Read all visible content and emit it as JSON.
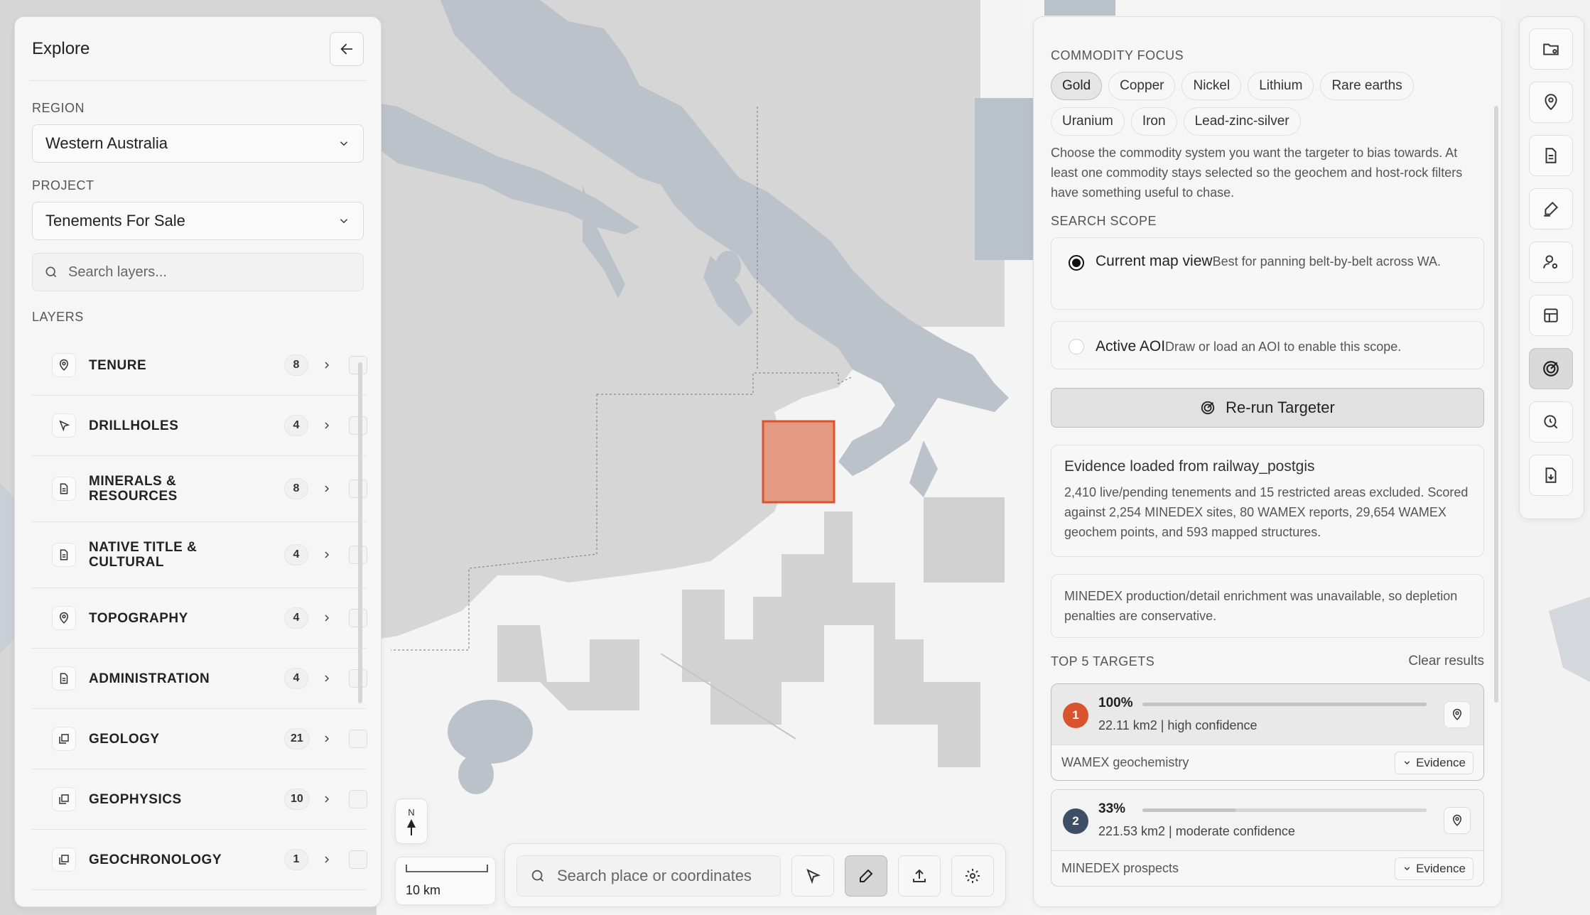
{
  "left_panel": {
    "title": "Explore",
    "region_label": "REGION",
    "region_value": "Western Australia",
    "project_label": "PROJECT",
    "project_value": "Tenements For Sale",
    "search_placeholder": "Search layers...",
    "layers_label": "LAYERS",
    "layers": [
      {
        "name": "TENURE",
        "count": "8",
        "icon": "pin-icon"
      },
      {
        "name": "DRILLHOLES",
        "count": "4",
        "icon": "cursor-icon"
      },
      {
        "name": "MINERALS & RESOURCES",
        "count": "8",
        "icon": "document-icon"
      },
      {
        "name": "NATIVE TITLE & CULTURAL",
        "count": "4",
        "icon": "document-icon"
      },
      {
        "name": "TOPOGRAPHY",
        "count": "4",
        "icon": "pin-icon"
      },
      {
        "name": "ADMINISTRATION",
        "count": "4",
        "icon": "document-icon"
      },
      {
        "name": "GEOLOGY",
        "count": "21",
        "icon": "layers-icon"
      },
      {
        "name": "GEOPHYSICS",
        "count": "10",
        "icon": "layers-icon"
      },
      {
        "name": "GEOCHRONOLOGY",
        "count": "1",
        "icon": "layers-icon"
      }
    ]
  },
  "right_panel": {
    "commodity_label": "COMMODITY FOCUS",
    "commodities": [
      {
        "label": "Gold",
        "selected": true
      },
      {
        "label": "Copper",
        "selected": false
      },
      {
        "label": "Nickel",
        "selected": false
      },
      {
        "label": "Lithium",
        "selected": false
      },
      {
        "label": "Rare earths",
        "selected": false
      },
      {
        "label": "Uranium",
        "selected": false
      },
      {
        "label": "Iron",
        "selected": false
      },
      {
        "label": "Lead-zinc-silver",
        "selected": false
      }
    ],
    "commodity_desc": "Choose the commodity system you want the targeter to bias towards. At least one commodity stays selected so the geochem and host-rock filters have something useful to chase.",
    "scope_label": "SEARCH SCOPE",
    "scope_options": [
      {
        "title": "Current map view",
        "desc": "Best for panning belt-by-belt across WA.",
        "selected": true
      },
      {
        "title": "Active AOI",
        "desc": "Draw or load an AOI to enable this scope.",
        "selected": false
      }
    ],
    "rerun_label": "Re-run Targeter",
    "evidence_title": "Evidence loaded from railway_postgis",
    "evidence_desc": "2,410 live/pending tenements and 15 restricted areas excluded. Scored against 2,254 MINEDEX sites, 80 WAMEX reports, 29,654 WAMEX geochem points, and 593 mapped structures.",
    "note": "MINEDEX production/detail enrichment was unavailable, so depletion penalties are conservative.",
    "targets_label": "TOP 5 TARGETS",
    "clear_label": "Clear results",
    "evidence_button": "Evidence",
    "targets": [
      {
        "rank": "1",
        "pct": "100%",
        "fraction": 1.0,
        "detail": "22.11 km2 | high confidence",
        "source": "WAMEX geochemistry",
        "color": "#d9532f"
      },
      {
        "rank": "2",
        "pct": "33%",
        "fraction": 0.33,
        "detail": "221.53 km2 | moderate confidence",
        "source": "MINEDEX prospects",
        "color": "#3d4e66"
      }
    ]
  },
  "map": {
    "compass": "N",
    "scale": "10 km",
    "search_placeholder": "Search place or coordinates",
    "highlight_color": "#e49a80",
    "highlight_border": "#d9532f"
  },
  "toolbar_icons": [
    "folder-settings-icon",
    "location-pin-icon",
    "document-icon",
    "brush-icon",
    "user-settings-icon",
    "table-icon",
    "target-icon",
    "search-history-icon",
    "export-document-icon"
  ]
}
